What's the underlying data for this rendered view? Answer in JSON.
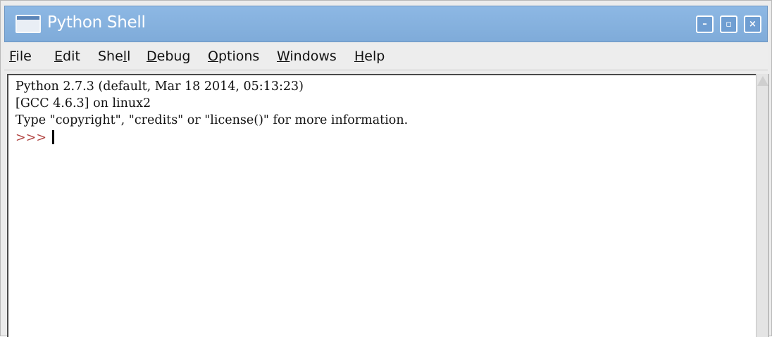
{
  "window": {
    "title": "Python Shell",
    "buttons": {
      "minimize": "–",
      "maximize": "▫",
      "close": "×"
    }
  },
  "menu": [
    {
      "pre": "",
      "u": "F",
      "post": "ile"
    },
    {
      "pre": "",
      "u": "E",
      "post": "dit"
    },
    {
      "pre": "She",
      "u": "l",
      "post": "l"
    },
    {
      "pre": "",
      "u": "D",
      "post": "ebug"
    },
    {
      "pre": "",
      "u": "O",
      "post": "ptions"
    },
    {
      "pre": "",
      "u": "W",
      "post": "indows"
    },
    {
      "pre": "",
      "u": "H",
      "post": "elp"
    }
  ],
  "shell": {
    "lines": [
      "Python 2.7.3 (default, Mar 18 2014, 05:13:23)",
      "[GCC 4.6.3] on linux2",
      "Type \"copyright\", \"credits\" or \"license()\" for more information."
    ],
    "prompt": ">>>"
  },
  "colors": {
    "titlebar": "#8db8e4",
    "prompt": "#b0413e"
  },
  "icons": {
    "app": "window-icon",
    "scroll_up": "arrow-up-icon"
  }
}
